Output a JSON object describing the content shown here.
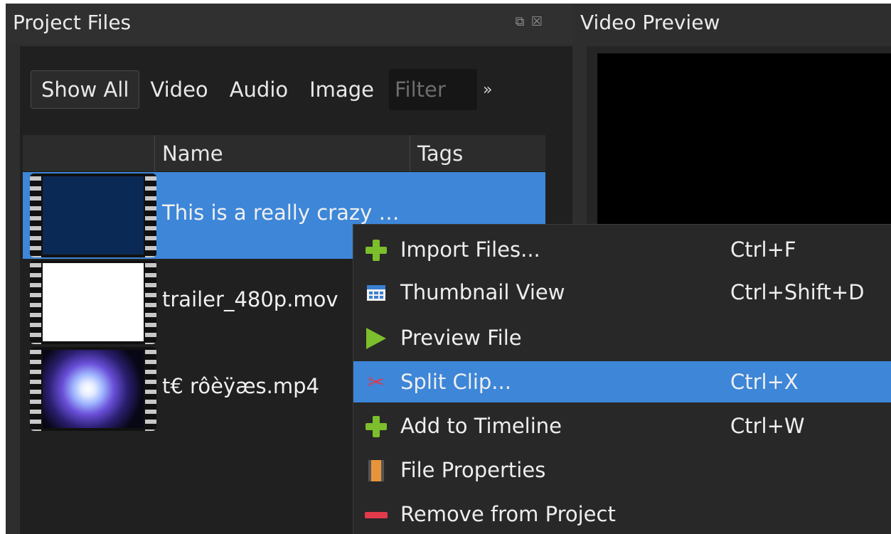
{
  "project_panel": {
    "title": "Project Files",
    "filters": [
      "Show All",
      "Video",
      "Audio",
      "Image"
    ],
    "filter_placeholder": "Filter",
    "overflow": "»",
    "columns": [
      "",
      "Name",
      "Tags"
    ],
    "files": [
      {
        "name": "This is a really crazy …",
        "tags": "",
        "selected": true,
        "thumb": "blue-title-frame"
      },
      {
        "name": "trailer_480p.mov",
        "tags": "",
        "selected": false,
        "thumb": "white-frame"
      },
      {
        "name": "t€ rôèÿæs.mp4",
        "tags": "",
        "selected": false,
        "thumb": "disco-ball-frame"
      }
    ]
  },
  "preview_panel": {
    "title": "Video Preview"
  },
  "context_menu": {
    "items": [
      {
        "label": "Import Files...",
        "shortcut": "Ctrl+F",
        "icon": "plus-icon"
      },
      {
        "label": "Thumbnail View",
        "shortcut": "Ctrl+Shift+D",
        "icon": "thumbnail-grid-icon"
      },
      {
        "label": "Preview File",
        "shortcut": "",
        "icon": "play-icon"
      },
      {
        "label": "Split Clip...",
        "shortcut": "Ctrl+X",
        "icon": "scissors-icon",
        "highlighted": true
      },
      {
        "label": "Add to Timeline",
        "shortcut": "Ctrl+W",
        "icon": "plus-icon"
      },
      {
        "label": "File Properties",
        "shortcut": "",
        "icon": "file-properties-icon"
      },
      {
        "label": "Remove from Project",
        "shortcut": "",
        "icon": "minus-icon"
      }
    ]
  },
  "colors": {
    "accent": "#3d86d8",
    "green_icon": "#7cbe2c",
    "red_icon": "#e23a4a"
  }
}
